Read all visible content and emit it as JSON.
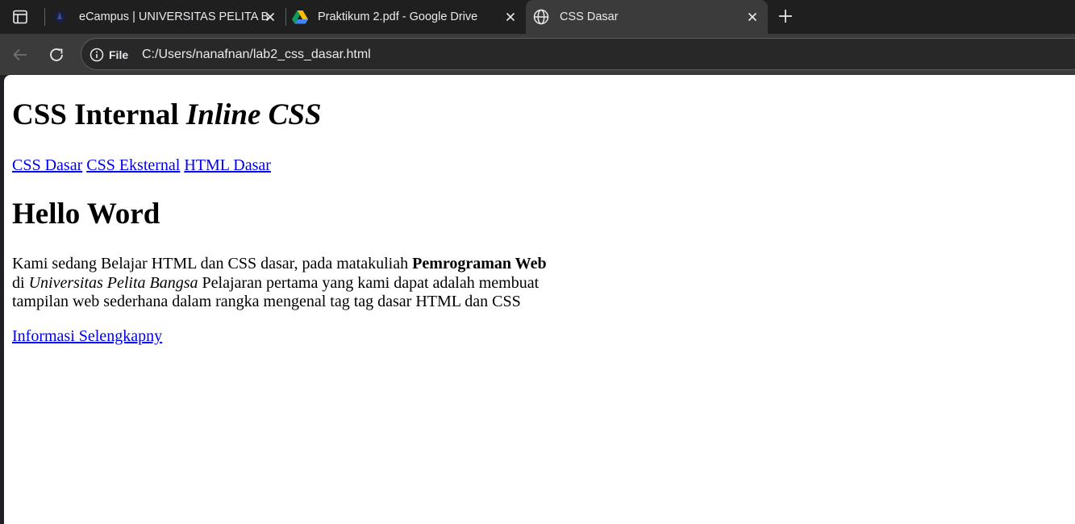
{
  "tabs": [
    {
      "title": "eCampus | UNIVERSITAS PELITA B",
      "favicon": "campus-logo-icon",
      "active": false
    },
    {
      "title": "Praktikum 2.pdf - Google Drive",
      "favicon": "google-drive-icon",
      "active": false
    },
    {
      "title": "CSS Dasar",
      "favicon": "globe-icon",
      "active": true
    }
  ],
  "toolbar": {
    "site_chip_label": "File",
    "url": "C:/Users/nanafnan/lab2_css_dasar.html"
  },
  "page": {
    "heading1_plain": "CSS Internal ",
    "heading1_italic": "Inline CSS",
    "nav_links": [
      "CSS Dasar",
      "CSS Eksternal",
      "HTML Dasar"
    ],
    "heading2": "Hello Word",
    "paragraph": {
      "part1": "Kami sedang Belajar HTML dan CSS dasar, pada matakuliah ",
      "bold": "Pemrograman Web",
      "part2": " di ",
      "italic": "Universitas Pelita Bangsa",
      "part3": " Pelajaran pertama yang kami dapat adalah membuat tampilan web sederhana dalam rangka mengenal tag tag dasar HTML dan CSS"
    },
    "more_link": "Informasi Selengkapny"
  },
  "colors": {
    "tabstrip_bg": "#1f1f1f",
    "toolbar_bg": "#3b3b3b",
    "link": "#0000ee"
  }
}
